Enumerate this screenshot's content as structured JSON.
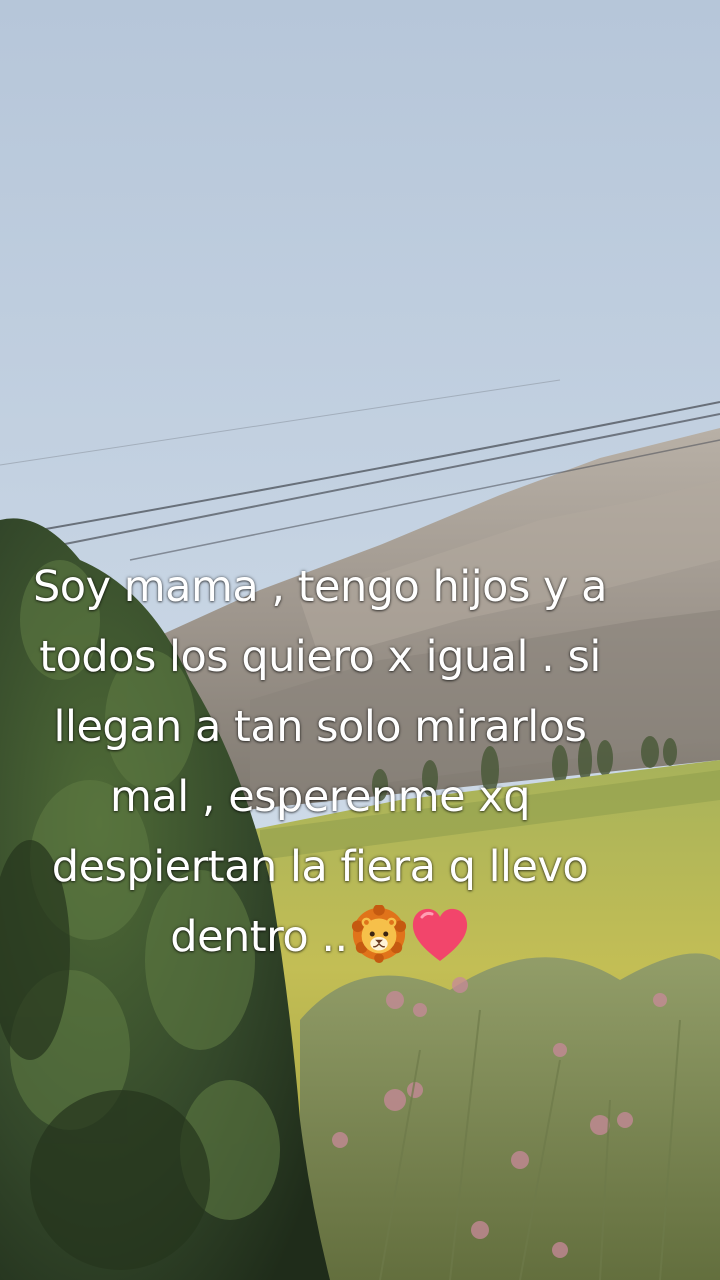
{
  "caption": {
    "lines": [
      "Soy mama , tengo hijos y a",
      "todos los quiero x igual . si",
      "llegan a tan solo mirarlos",
      "mal , esperenme xq",
      "despiertan la fiera q llevo",
      "dentro .."
    ],
    "emojis": [
      "lion-face-icon",
      "heart-icon"
    ]
  },
  "colors": {
    "sky_top": "#b9c9dc",
    "sky_bottom": "#d6e1ec",
    "mountain": "#a9a29a",
    "field": "#b7b651",
    "foliage": "#3f5a2c",
    "caption_text": "#ffffff"
  }
}
